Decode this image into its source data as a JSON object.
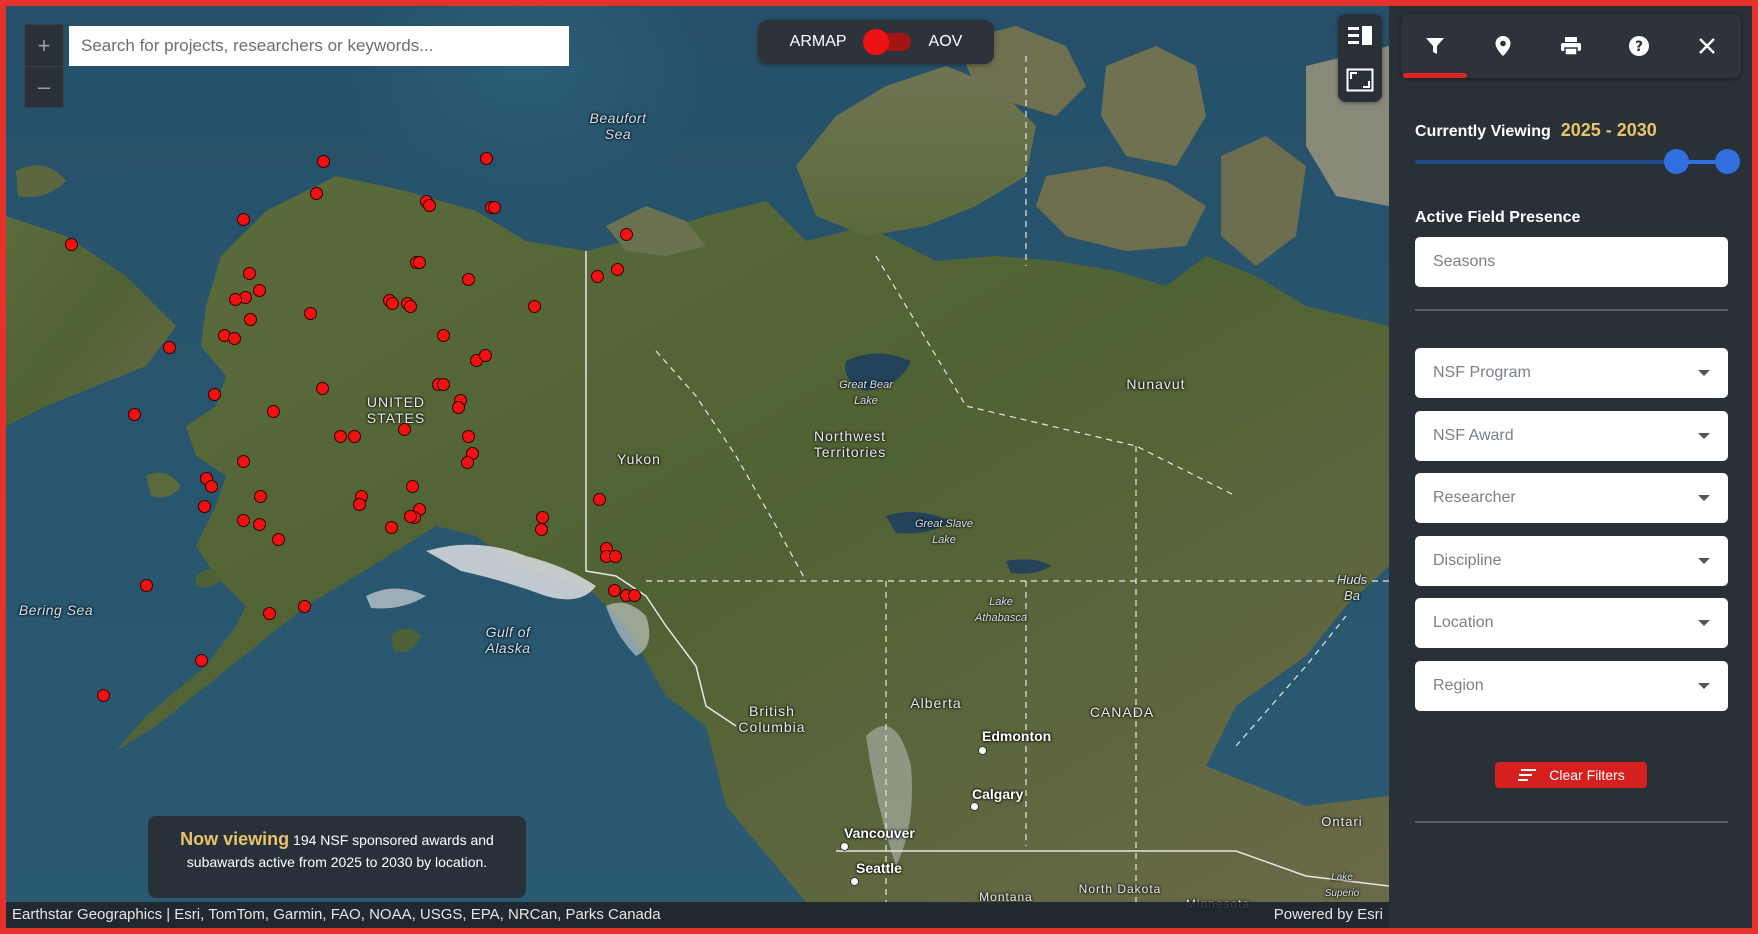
{
  "search": {
    "placeholder": "Search for projects, researchers or keywords..."
  },
  "zoom": {
    "in_label": "+",
    "out_label": "–"
  },
  "toggle": {
    "left_label": "ARMAP",
    "right_label": "AOV",
    "active": "ARMAP"
  },
  "map_buttons": {
    "list_icon": "list-view-icon",
    "fullscreen_icon": "fullscreen-icon"
  },
  "map_labels": {
    "beaufort": "Beaufort\nSea",
    "bering": "Bering Sea",
    "gulf": "Gulf of\nAlaska",
    "us": "UNITED\nSTATES",
    "yukon": "Yukon",
    "nwt": "Northwest\nTerritories",
    "nunavut": "Nunavut",
    "great_bear": "Great Bear\nLake",
    "great_slave": "Great Slave\nLake",
    "athabasca": "Lake\nAthabasca",
    "bc": "British\nColumbia",
    "alberta": "Alberta",
    "canada": "CANADA",
    "hudson": "Huds\nBa",
    "ontario": "Ontari",
    "lake_superior": "Lake\nSuperio",
    "montana": "Montana",
    "north_dakota": "North Dakota",
    "minnesota": "Minnesota"
  },
  "cities": {
    "edmonton": "Edmonton",
    "calgary": "Calgary",
    "vancouver": "Vancouver",
    "seattle": "Seattle"
  },
  "now_viewing": {
    "highlight": "Now viewing",
    "count": "194",
    "line1_rest": "NSF sponsored awards and",
    "line2": "subawards active from 2025 to 2030 by location."
  },
  "attribution": {
    "left": "Earthstar Geographics | Esri, TomTom, Garmin, FAO, NOAA, USGS, EPA, NRCan, Parks Canada",
    "right": "Powered by Esri"
  },
  "panel": {
    "tabs": [
      {
        "icon": "filter-icon",
        "active": true
      },
      {
        "icon": "location-pin-icon",
        "active": false
      },
      {
        "icon": "print-icon",
        "active": false
      },
      {
        "icon": "help-icon",
        "active": false
      },
      {
        "icon": "close-icon",
        "active": false
      }
    ],
    "currently_viewing": "Currently Viewing",
    "year_range": "2025 - 2030",
    "slider": {
      "low": 2025,
      "high": 2030
    },
    "active_field_presence": "Active Field Presence",
    "seasons_placeholder": "Seasons",
    "dropdowns": [
      "NSF Program",
      "NSF Award",
      "Researcher",
      "Discipline",
      "Location",
      "Region"
    ],
    "clear_filters": "Clear Filters"
  },
  "colors": {
    "accent_red": "#e02424",
    "pin_red": "#ef1212",
    "gold": "#e8c46a",
    "slider_blue": "#2f6fe0",
    "panel_bg": "#2a3038"
  }
}
